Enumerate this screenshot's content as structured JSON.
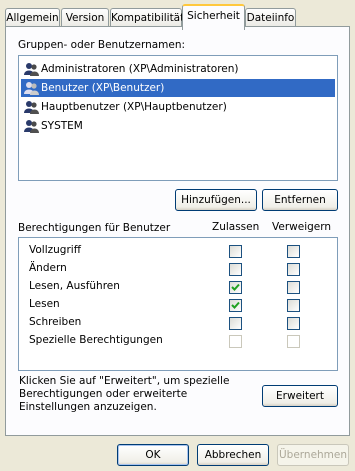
{
  "tabs": [
    "Allgemein",
    "Version",
    "Kompatibilität",
    "Sicherheit",
    "Dateiinfo"
  ],
  "active_tab": "Sicherheit",
  "groups_label": "Gruppen- oder Benutzernamen:",
  "users": [
    {
      "name": "Administratoren (XP\\Administratoren)",
      "selected": false,
      "icon": "user-group-icon"
    },
    {
      "name": "Benutzer (XP\\Benutzer)",
      "selected": true,
      "icon": "user-group-icon"
    },
    {
      "name": "Hauptbenutzer (XP\\Hauptbenutzer)",
      "selected": false,
      "icon": "user-group-icon"
    },
    {
      "name": "SYSTEM",
      "selected": false,
      "icon": "user-group-icon"
    }
  ],
  "buttons": {
    "add": "Hinzufügen...",
    "remove": "Entfernen",
    "advanced": "Erweitert",
    "ok": "OK",
    "cancel": "Abbrechen",
    "apply": "Übernehmen"
  },
  "permissions": {
    "title": "Berechtigungen für Benutzer",
    "allow_header": "Zulassen",
    "deny_header": "Verweigern",
    "rows": [
      {
        "name": "Vollzugriff",
        "allow": false,
        "deny": false,
        "disabled": false
      },
      {
        "name": "Ändern",
        "allow": false,
        "deny": false,
        "disabled": false
      },
      {
        "name": "Lesen, Ausführen",
        "allow": true,
        "deny": false,
        "disabled": false
      },
      {
        "name": "Lesen",
        "allow": true,
        "deny": false,
        "disabled": false
      },
      {
        "name": "Schreiben",
        "allow": false,
        "deny": false,
        "disabled": false
      },
      {
        "name": "Spezielle Berechtigungen",
        "allow": false,
        "deny": false,
        "disabled": true
      }
    ]
  },
  "advanced_hint": "Klicken Sie auf \"Erweitert\", um spezielle Berechtigungen oder erweiterte Einstellungen anzuzeigen.",
  "colors": {
    "selection": "#316ac5",
    "tab_highlight": "#ffc83c",
    "checkmark": "#21a121"
  }
}
